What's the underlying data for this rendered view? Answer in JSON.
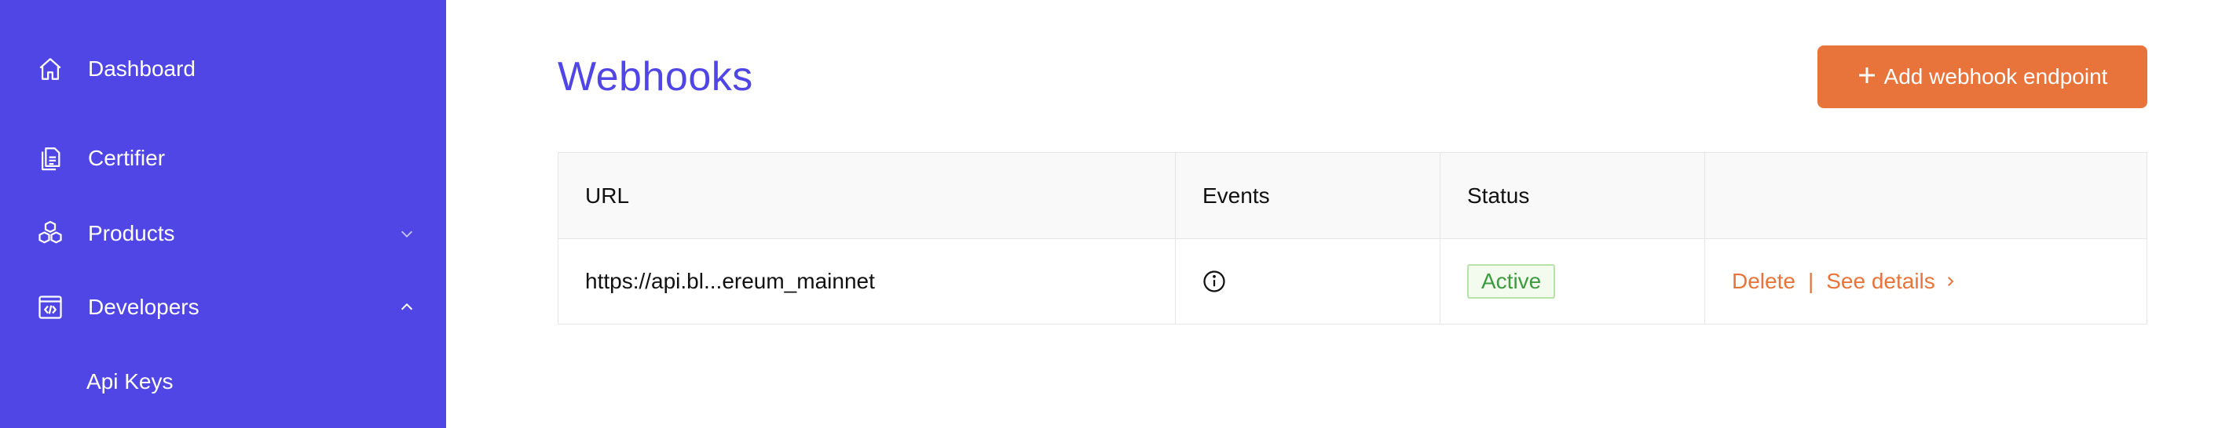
{
  "sidebar": {
    "items": [
      {
        "label": "Dashboard",
        "icon": "home-icon"
      },
      {
        "label": "Certifier",
        "icon": "document-icon"
      },
      {
        "label": "Products",
        "icon": "cubes-icon",
        "expanded": false
      },
      {
        "label": "Developers",
        "icon": "code-window-icon",
        "expanded": true
      }
    ],
    "sub_items": [
      {
        "label": "Api Keys"
      }
    ],
    "background": "#4f46e5"
  },
  "main": {
    "title": "Webhooks",
    "add_button": {
      "label": "Add webhook endpoint",
      "icon": "plus-icon",
      "color": "#e8743b"
    },
    "table": {
      "columns": [
        "URL",
        "Events",
        "Status",
        ""
      ],
      "rows": [
        {
          "url": "https://api.bl...ereum_mainnet",
          "events_icon": "info-icon",
          "status": "Active",
          "delete_label": "Delete",
          "separator": "|",
          "details_label": "See details"
        }
      ]
    }
  },
  "colors": {
    "accent": "#4f46e5",
    "action": "#e8743b",
    "status_active": "#3d9a3d"
  }
}
